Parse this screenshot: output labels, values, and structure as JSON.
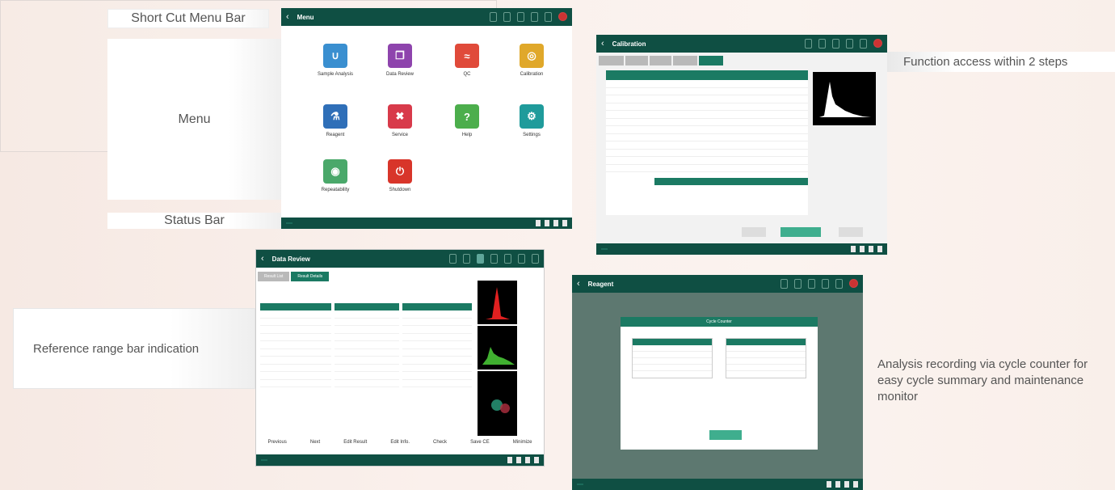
{
  "callouts": {
    "shortcut": "Short Cut Menu Bar",
    "menu": "Menu",
    "status": "Status Bar",
    "function_access": "Function access within 2 steps",
    "reference_range": "Reference range bar indication",
    "cycle_counter": "Analysis recording via cycle counter for easy cycle summary and maintenance monitor"
  },
  "screens": {
    "menu": {
      "title": "Menu",
      "items": [
        {
          "label": "Sample Analysis",
          "color": "#3a8fd0",
          "icon": "test-tube-icon"
        },
        {
          "label": "Data Review",
          "color": "#8e44ad",
          "icon": "documents-icon"
        },
        {
          "label": "QC",
          "color": "#e04a3a",
          "icon": "qc-chart-icon"
        },
        {
          "label": "Calibration",
          "color": "#e0a82a",
          "icon": "calibration-icon"
        },
        {
          "label": "Reagent",
          "color": "#2f6fb8",
          "icon": "flask-icon"
        },
        {
          "label": "Service",
          "color": "#d83a4a",
          "icon": "tools-icon"
        },
        {
          "label": "Help",
          "color": "#4cae4c",
          "icon": "help-icon"
        },
        {
          "label": "Settings",
          "color": "#1f9b9b",
          "icon": "gear-icon"
        },
        {
          "label": "Repeatability",
          "color": "#4aa86a",
          "icon": "target-icon"
        },
        {
          "label": "Shutdown",
          "color": "#d8352a",
          "icon": "power-icon"
        }
      ]
    },
    "calibration": {
      "title": "Calibration"
    },
    "data_review": {
      "title": "Data Review",
      "tabs": [
        "Result List",
        "Result Details"
      ],
      "buttons": [
        "Previous",
        "Next",
        "Edit Result",
        "Edit Info.",
        "Check",
        "Save CE",
        "Minimize"
      ]
    },
    "reagent": {
      "title": "Reagent",
      "dialog_title": "Cycle Counter"
    }
  }
}
